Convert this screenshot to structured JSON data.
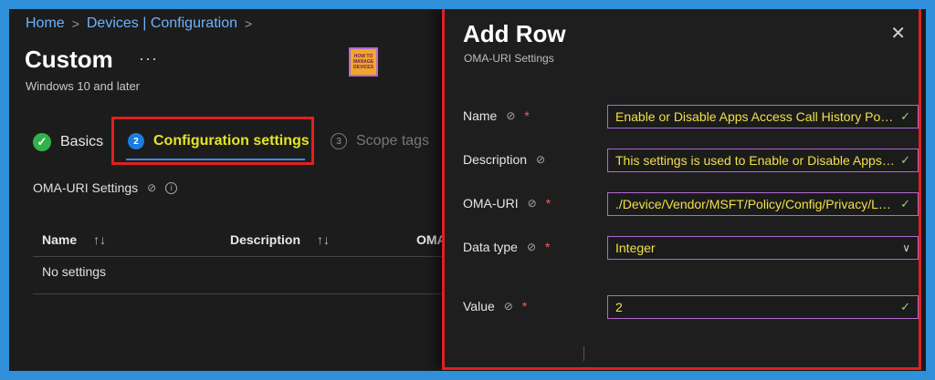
{
  "breadcrumb": {
    "home": "Home",
    "devices": "Devices | Configuration",
    "sep": ">"
  },
  "page": {
    "title": "Custom",
    "more": "···",
    "subtitle": "Windows 10 and later"
  },
  "logo": {
    "line1": "HOW TO",
    "line2": "MANAGE",
    "line3": "DEVICES"
  },
  "tabs": [
    {
      "label": "Basics",
      "badge": "✓"
    },
    {
      "label": "Configuration settings",
      "badge": "2"
    },
    {
      "label": "Scope tags",
      "badge": "3"
    }
  ],
  "oma_section": {
    "label": "OMA-URI Settings"
  },
  "table": {
    "headers": [
      "Name",
      "Description",
      "OMA"
    ],
    "sort_icon": "↑↓",
    "empty": "No settings"
  },
  "panel": {
    "title": "Add Row",
    "subtitle": "OMA-URI Settings",
    "close": "✕",
    "fields": {
      "name": {
        "label": "Name",
        "value": "Enable or Disable Apps Access Call History Policy"
      },
      "description": {
        "label": "Description",
        "value": "This settings is used to Enable or Disable Apps Access"
      },
      "omauri": {
        "label": "OMA-URI",
        "value": "./Device/Vendor/MSFT/Policy/Config/Privacy/LetAppsAccessCallHistory"
      },
      "datatype": {
        "label": "Data type",
        "value": "Integer"
      },
      "value": {
        "label": "Value",
        "value": "2"
      }
    },
    "required_mark": "*"
  },
  "colors": {
    "accent": "#e4e428",
    "highlight_border": "#e02020",
    "field_border": "#b06bd0",
    "link": "#6db2ff"
  }
}
